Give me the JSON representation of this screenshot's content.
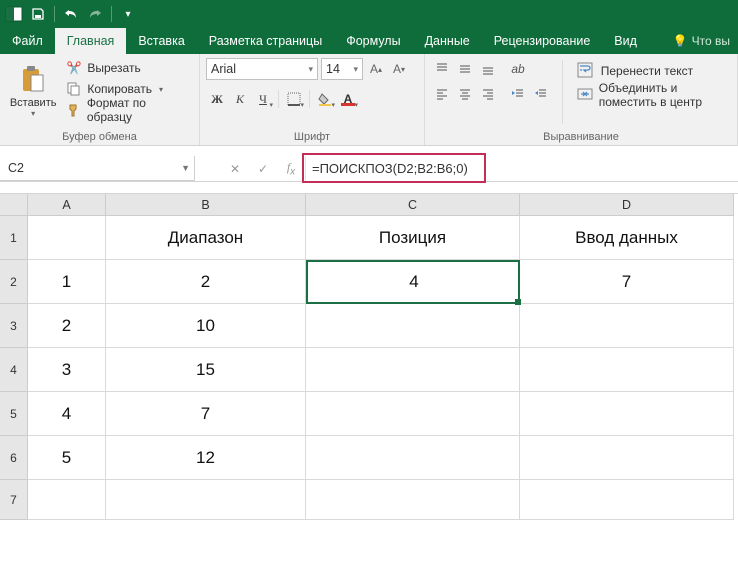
{
  "qat": {
    "save": "save",
    "undo": "undo",
    "redo": "redo"
  },
  "tabs": {
    "file": "Файл",
    "home": "Главная",
    "insert": "Вставка",
    "layout": "Разметка страницы",
    "formulas": "Формулы",
    "data": "Данные",
    "review": "Рецензирование",
    "view": "Вид",
    "tellme": "Что вы"
  },
  "clipboard": {
    "paste": "Вставить",
    "cut": "Вырезать",
    "copy": "Копировать",
    "format_painter": "Формат по образцу",
    "group_label": "Буфер обмена"
  },
  "font": {
    "name": "Arial",
    "size": "14",
    "group_label": "Шрифт"
  },
  "align": {
    "wrap": "Перенести текст",
    "merge": "Объединить и поместить в центр",
    "group_label": "Выравнивание"
  },
  "namebox": "C2",
  "formula": "=ПОИСКПОЗ(D2;B2:B6;0)",
  "sheet": {
    "cols": [
      "A",
      "B",
      "C",
      "D"
    ],
    "rows": [
      "1",
      "2",
      "3",
      "4",
      "5",
      "6",
      "7"
    ],
    "headers": {
      "B": "Диапазон",
      "C": "Позиция",
      "D": "Ввод данных"
    },
    "colA": [
      "1",
      "2",
      "3",
      "4",
      "5"
    ],
    "colB": [
      "2",
      "10",
      "15",
      "7",
      "12"
    ],
    "C2": "4",
    "D2": "7"
  }
}
